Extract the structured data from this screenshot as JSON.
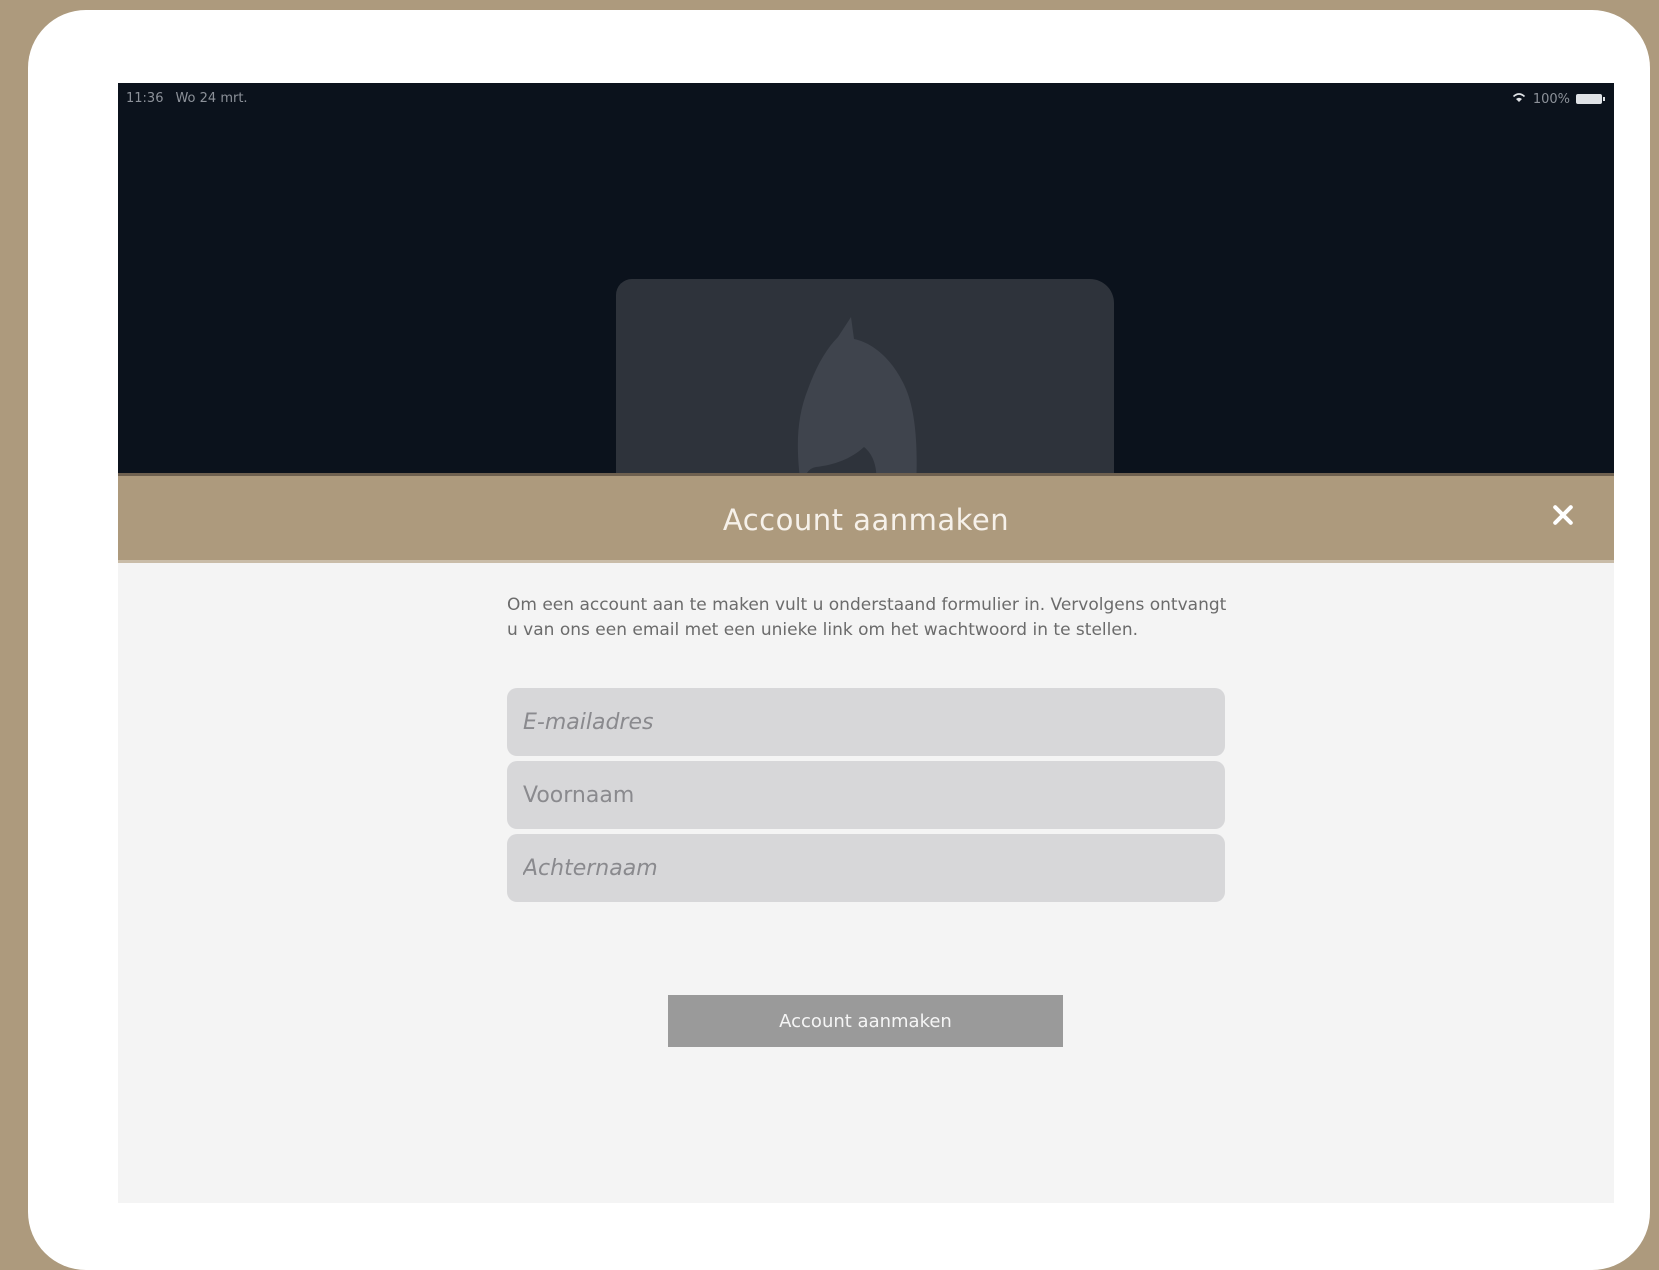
{
  "status_bar": {
    "time": "11:36",
    "date": "Wo 24 mrt.",
    "battery": "100%"
  },
  "modal": {
    "title": "Account aanmaken",
    "intro": "Om een account aan te maken vult u onderstaand formulier in. Vervolgens ontvangt u van ons een email met een unieke link om het wachtwoord in te stellen.",
    "fields": {
      "email_placeholder": "E-mailadres",
      "firstname_placeholder": "Voornaam",
      "lastname_placeholder": "Achternaam"
    },
    "submit_label": "Account aanmaken"
  },
  "colors": {
    "accent": "#ad9a7d",
    "hero_background": "#0b121c",
    "button": "#9a9a9a"
  },
  "icons": {
    "close": "close-icon",
    "wifi": "wifi-icon",
    "battery": "battery-icon",
    "logo": "horse-head-logo"
  }
}
